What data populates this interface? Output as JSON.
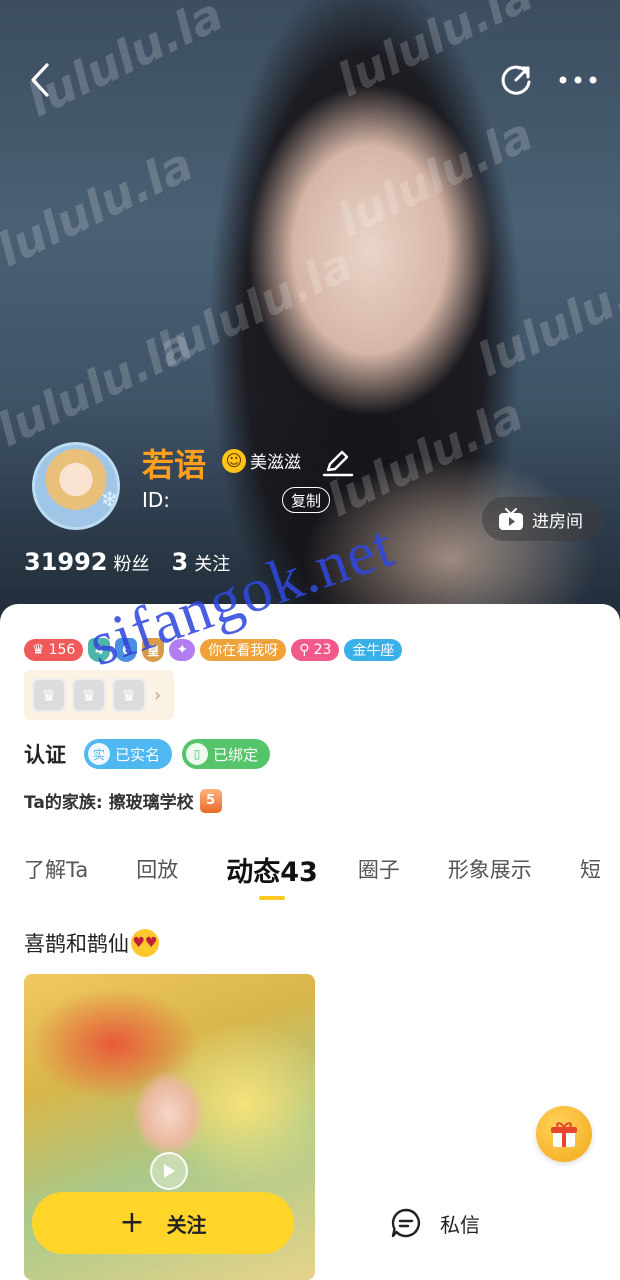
{
  "header": {
    "back_icon": "chevron-left-icon",
    "share_icon": "share-icon",
    "more_icon": "more-dots-icon"
  },
  "profile": {
    "name": "若语",
    "badge_label": "美滋滋",
    "id_label": "ID:",
    "copy_label": "复制",
    "enter_room_label": "进房间",
    "fans_count": "31992",
    "fans_label": "粉丝",
    "following_count": "3",
    "following_label": "关注"
  },
  "badges": {
    "level": "156",
    "shield1": "4",
    "shield2": "6",
    "crown_text": "皇",
    "tag_text": "你在看我呀",
    "search_count": "23",
    "zodiac": "金牛座"
  },
  "verify": {
    "title": "认证",
    "realname_icon": "实",
    "realname_label": "已实名",
    "bound_label": "已绑定"
  },
  "family": {
    "label": "Ta的家族:",
    "name": "擦玻璃学校",
    "level": "5"
  },
  "tabs": [
    "了解Ta",
    "回放",
    "动态43",
    "圈子",
    "形象展示",
    "短"
  ],
  "post": {
    "title": "喜鹊和鹊仙"
  },
  "actions": {
    "follow_label": "关注",
    "message_label": "私信"
  },
  "watermarks": {
    "hero": "lululu.la",
    "overlay": "sifangok.net"
  },
  "colors": {
    "accent_yellow": "#ffd52a",
    "name_orange": "#ff9f1c",
    "level_red": "#f05a5a",
    "zodiac_blue": "#3ab0e8",
    "realname_blue": "#4fb8f0",
    "bound_green": "#56c46a"
  }
}
